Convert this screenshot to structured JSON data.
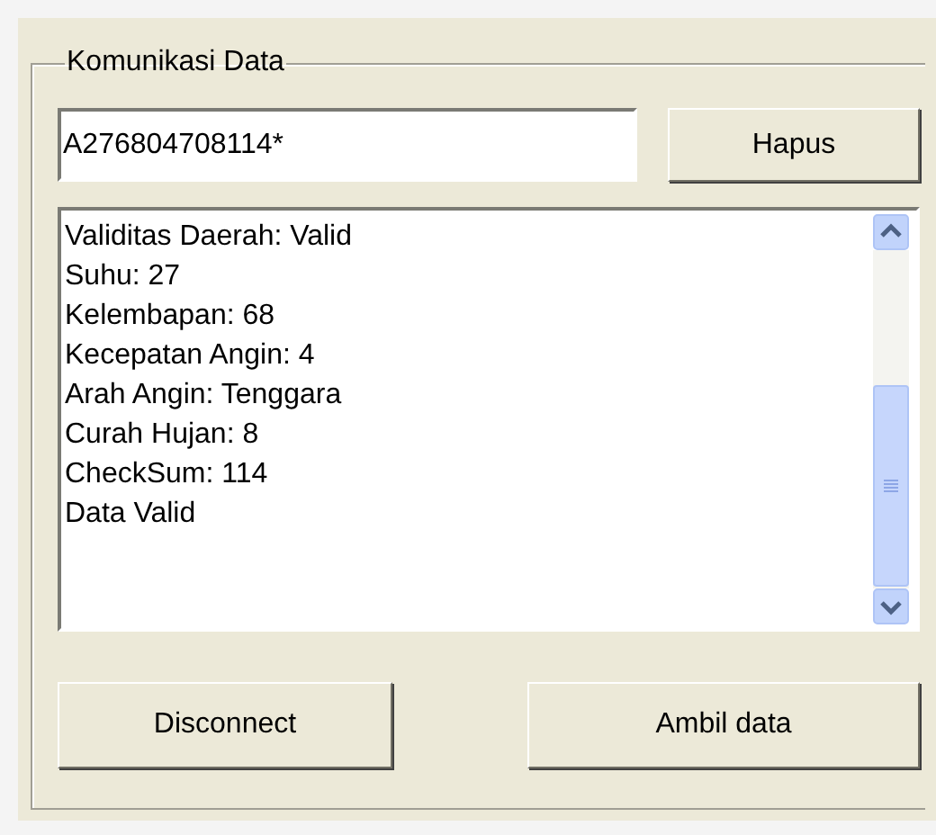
{
  "group": {
    "title": "Komunikasi Data"
  },
  "input": {
    "value": "A276804708114*"
  },
  "clear_button": {
    "label": "Hapus"
  },
  "log": {
    "lines": [
      "Validitas Daerah: Valid",
      "Suhu: 27",
      "Kelembapan: 68",
      "Kecepatan Angin: 4",
      "Arah Angin: Tenggara",
      "Curah Hujan: 8",
      "CheckSum: 114",
      "Data Valid"
    ]
  },
  "buttons": [
    {
      "label": "Disconnect"
    },
    {
      "label": "Ambil data"
    }
  ]
}
